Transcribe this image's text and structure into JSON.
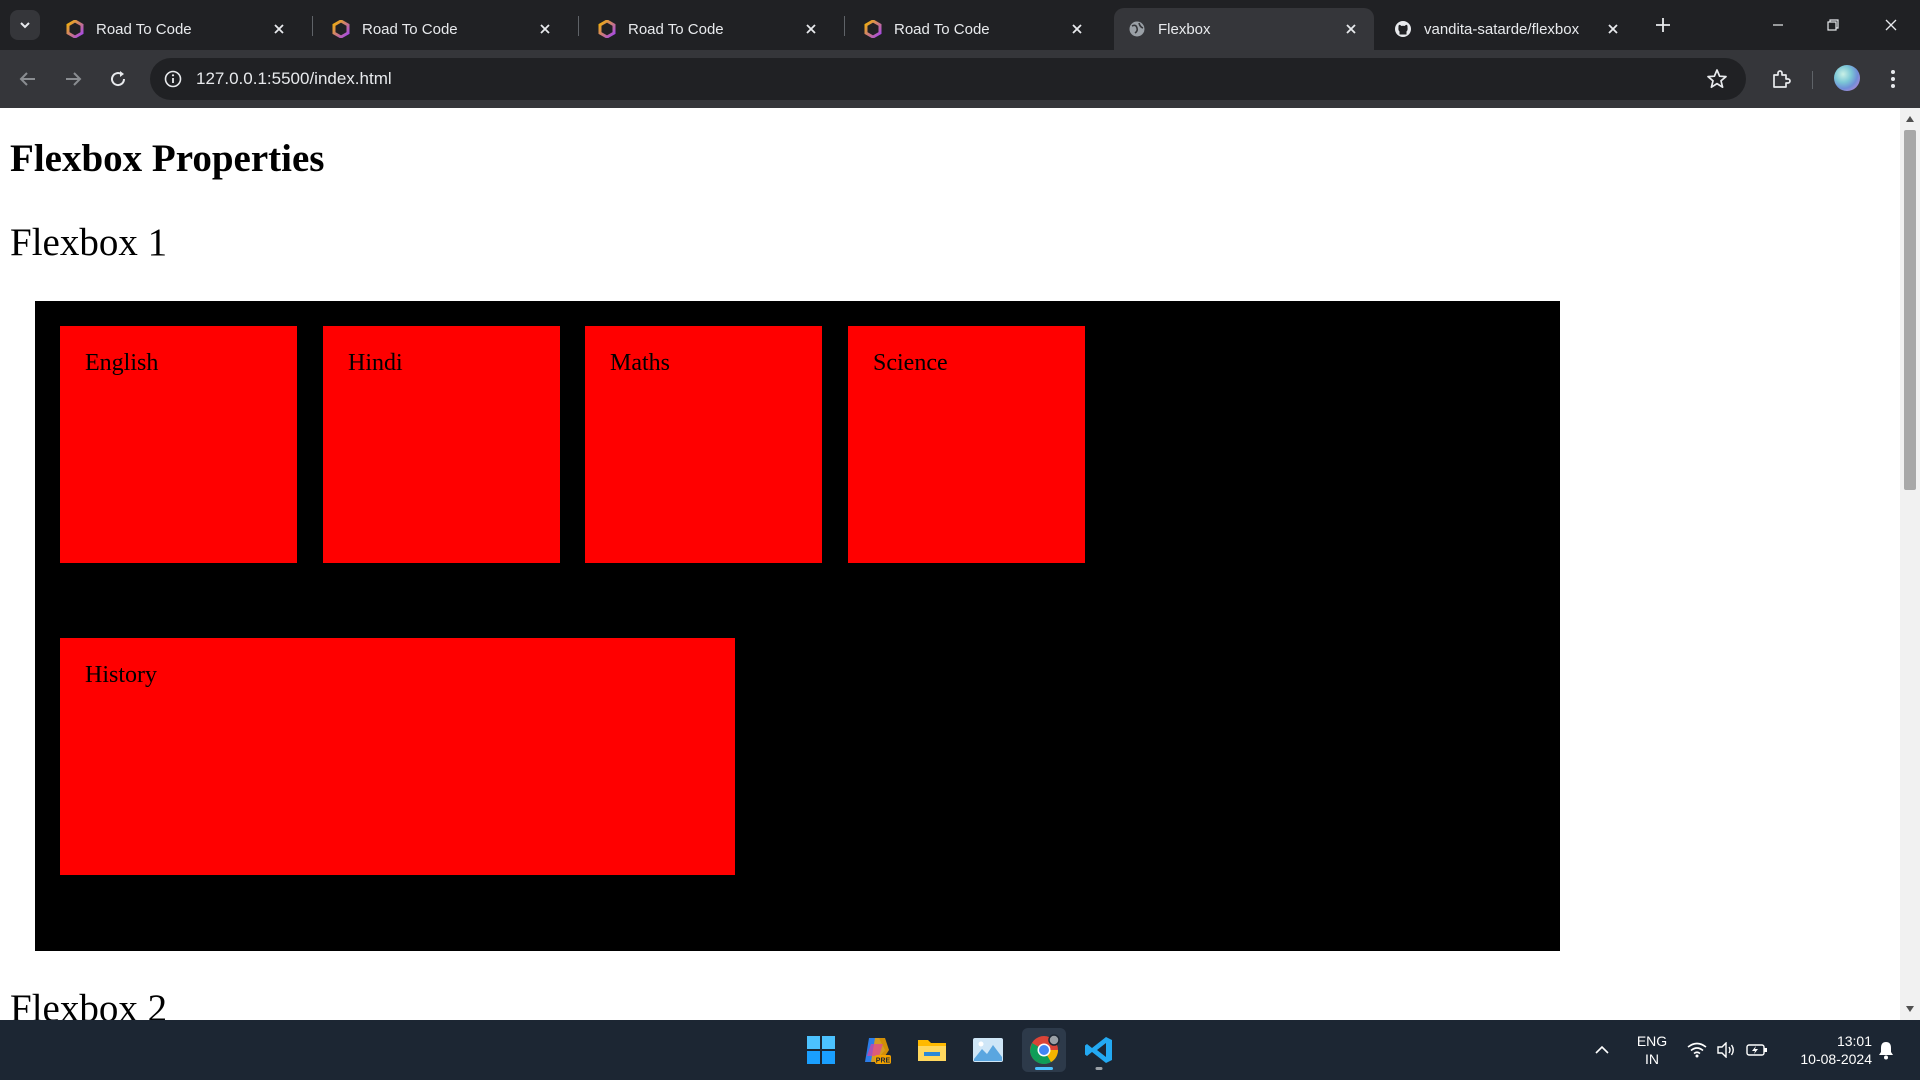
{
  "tabs": [
    {
      "title": "Road To Code",
      "favicon": "hexagon-icon",
      "active": false
    },
    {
      "title": "Road To Code",
      "favicon": "hexagon-icon",
      "active": false
    },
    {
      "title": "Road To Code",
      "favicon": "hexagon-icon",
      "active": false
    },
    {
      "title": "Road To Code",
      "favicon": "hexagon-icon",
      "active": false
    },
    {
      "title": "Flexbox",
      "favicon": "globe-icon",
      "active": true
    },
    {
      "title": "vandita-satarde/flexbox",
      "favicon": "github-icon",
      "active": false
    }
  ],
  "address_bar": {
    "url": "127.0.0.1:5500/index.html"
  },
  "page": {
    "heading": "Flexbox Properties",
    "section1_title": "Flexbox 1",
    "section2_title": "Flexbox 2",
    "flex_items": [
      "English",
      "Hindi",
      "Maths",
      "Science",
      "History"
    ]
  },
  "colors": {
    "container": "#000000",
    "item": "#ff0000",
    "chrome_dark": "#202124",
    "chrome_toolbar": "#35363a",
    "taskbar": "#1c2633"
  },
  "taskbar": {
    "apps": [
      "windows-start-icon",
      "copilot-icon",
      "file-explorer-icon",
      "photos-icon",
      "chrome-icon",
      "vscode-icon"
    ],
    "language": {
      "line1": "ENG",
      "line2": "IN"
    },
    "clock": {
      "time": "13:01",
      "date": "10-08-2024"
    }
  }
}
